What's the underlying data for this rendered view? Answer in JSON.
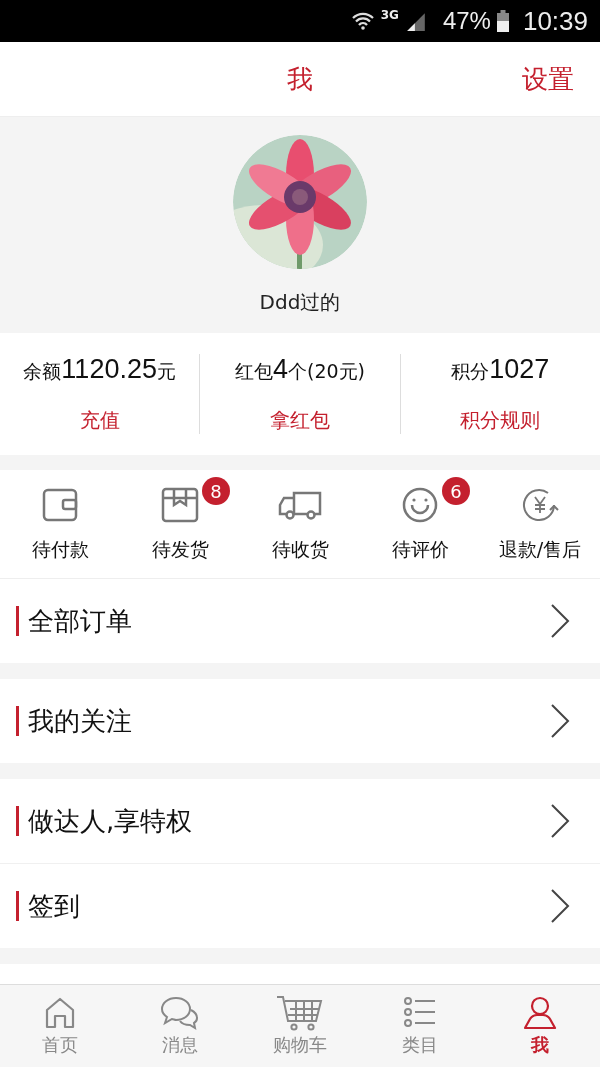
{
  "status_bar": {
    "network": "3G",
    "battery": "47%",
    "time": "10:39"
  },
  "header": {
    "title": "我",
    "action": "设置"
  },
  "profile": {
    "name": "Ddd过的"
  },
  "wallet": [
    {
      "label": "余额",
      "value": "1120.25",
      "unit": "元",
      "link": "充值"
    },
    {
      "label": "红包",
      "value": "4",
      "unit": "个(20元)",
      "link": "拿红包"
    },
    {
      "label": "积分",
      "value": "1027",
      "link": "积分规则"
    }
  ],
  "orders": [
    {
      "kind": "wallet",
      "label": "待付款"
    },
    {
      "kind": "box",
      "label": "待发货",
      "badge": "8"
    },
    {
      "kind": "truck",
      "label": "待收货"
    },
    {
      "kind": "smile",
      "label": "待评价",
      "badge": "6"
    },
    {
      "kind": "refund",
      "label": "退款/售后"
    }
  ],
  "menu_groups": [
    [
      {
        "label": "全部订单"
      }
    ],
    [
      {
        "label": "我的关注"
      }
    ],
    [
      {
        "label": "做达人,享特权"
      },
      {
        "label": "签到"
      }
    ]
  ],
  "tabs": [
    {
      "kind": "home",
      "label": "首页",
      "selected": false
    },
    {
      "kind": "chat",
      "label": "消息",
      "selected": false
    },
    {
      "kind": "cart",
      "label": "购物车",
      "selected": false
    },
    {
      "kind": "list",
      "label": "类目",
      "selected": false
    },
    {
      "kind": "user",
      "label": "我",
      "selected": true
    }
  ]
}
